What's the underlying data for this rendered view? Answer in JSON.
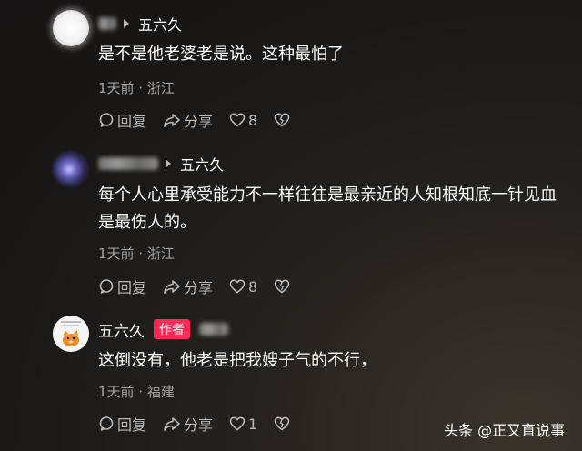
{
  "comments": [
    {
      "reply_to": "五六久",
      "text": "是不是他老婆老是说。这种最怕了",
      "meta": "1天前 · 浙江",
      "reply_label": "回复",
      "share_label": "分享",
      "likes": "8"
    },
    {
      "reply_to": "五六久",
      "text": "每个人心里承受能力不一样往往是最亲近的人知根知底一针见血是最伤人的。",
      "meta": "1天前 · 浙江",
      "reply_label": "回复",
      "share_label": "分享",
      "likes": "8"
    },
    {
      "author": "五六久",
      "author_badge": "作者",
      "text": "这倒没有，他老是把我嫂子气的不行，",
      "meta": "1天前 · 福建",
      "reply_label": "回复",
      "share_label": "分享",
      "likes": "1"
    }
  ],
  "watermark": "头条 @正又直说事",
  "icons": [
    "reply-icon",
    "share-icon",
    "heart-icon",
    "broken-heart-icon",
    "caret-right-icon"
  ],
  "colors": {
    "badge": "#ff2a55",
    "meta_text": "#a3a3a3",
    "action_text": "#b9b9b9"
  }
}
